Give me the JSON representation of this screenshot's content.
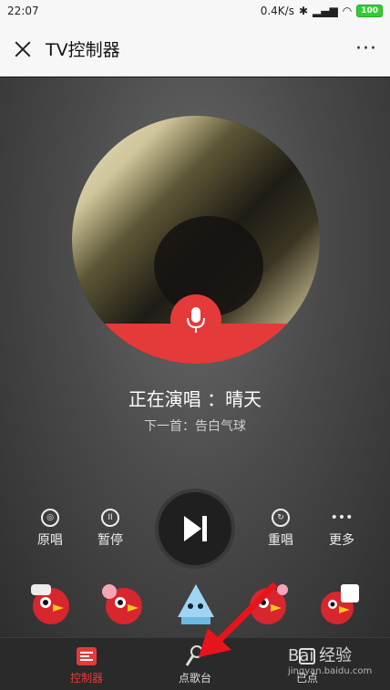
{
  "status": {
    "time": "22:07",
    "speed": "0.4K/s",
    "battery": "100"
  },
  "header": {
    "title": "TV控制器",
    "more": "···"
  },
  "player": {
    "now_playing": "正在演唱 ：晴天",
    "next_up": "下一首：告白气球"
  },
  "controls": {
    "original": "原唱",
    "pause": "暂停",
    "replay": "重唱",
    "more": "更多"
  },
  "emojis": [
    "parrot-emoji",
    "parrot-emoji",
    "ice-creature-emoji",
    "parrot-emoji",
    "parrot-emoji"
  ],
  "tabs": {
    "controller": "控制器",
    "song_station": "点歌台",
    "queued": "已点"
  },
  "watermark": {
    "brand": "Bai 经验",
    "site": "jingyan.baidu.com"
  },
  "colors": {
    "accent": "#e53a3a",
    "stage_bg": "#4b4b4b",
    "tabbar_bg": "#2a2a2a"
  }
}
